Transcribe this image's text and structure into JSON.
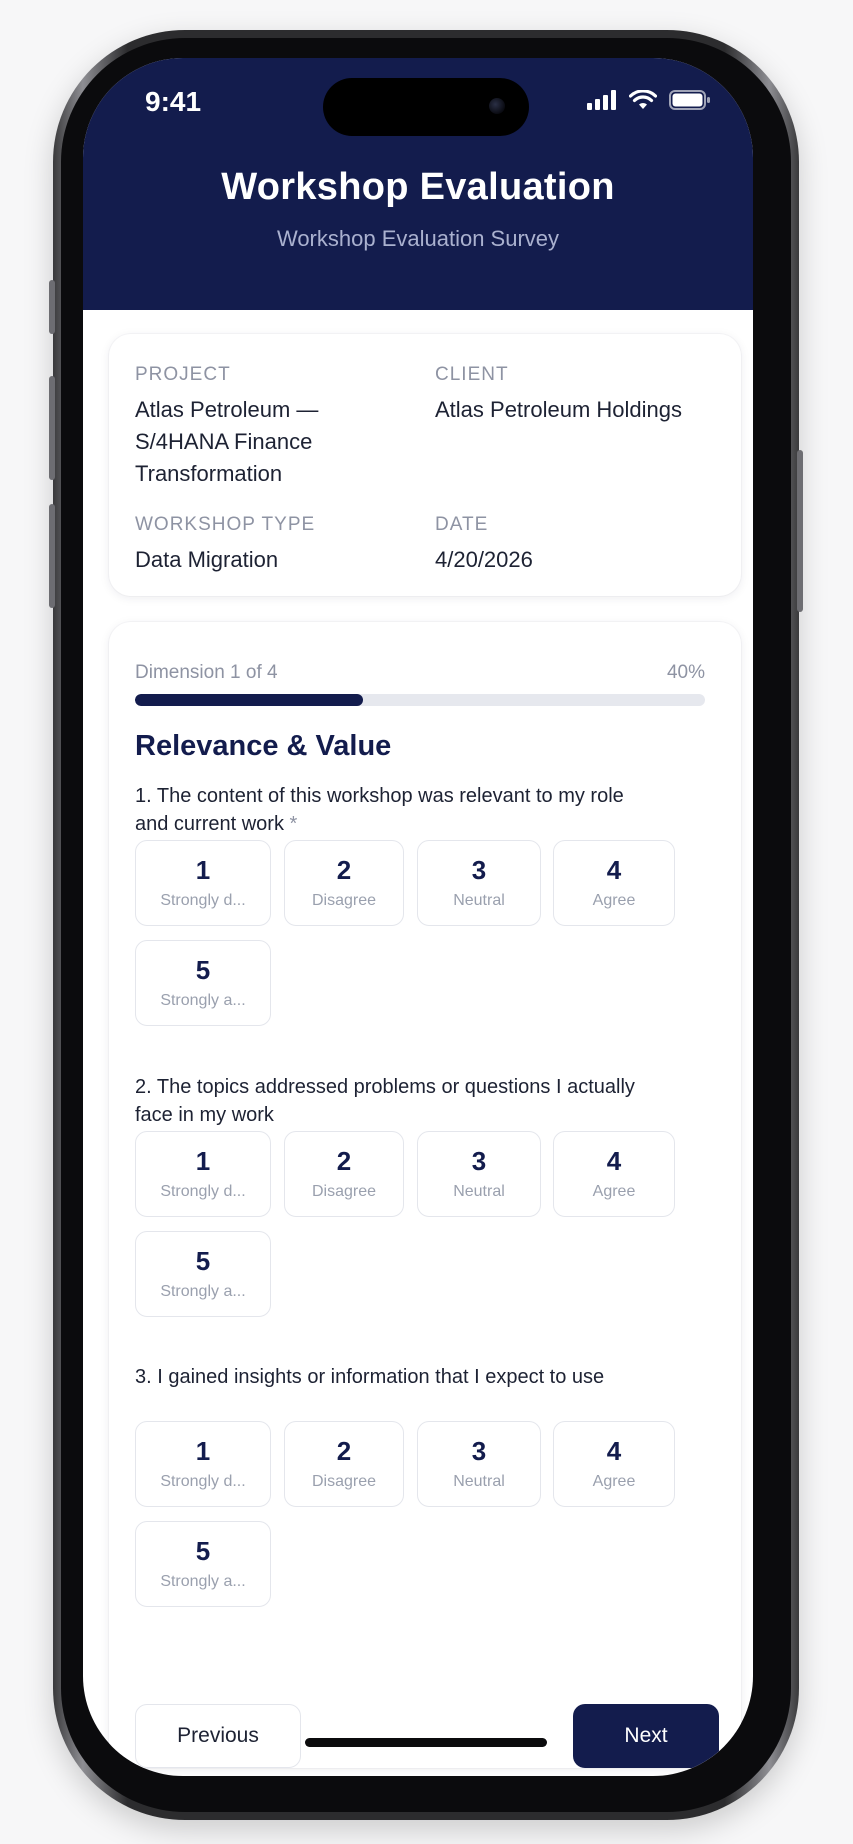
{
  "status_bar": {
    "time": "9:41"
  },
  "header": {
    "title": "Workshop Evaluation",
    "subtitle": "Workshop Evaluation Survey"
  },
  "info": {
    "project_label": "PROJECT",
    "project_value": "Atlas Petroleum — S/4HANA Finance Transformation",
    "client_label": "CLIENT",
    "client_value": "Atlas Petroleum Holdings",
    "type_label": "WORKSHOP TYPE",
    "type_value": "Data Migration",
    "date_label": "DATE",
    "date_value": "4/20/2026"
  },
  "progress": {
    "dimension_text": "Dimension 1 of 4",
    "percent_text": "40%",
    "percent": 40
  },
  "section": {
    "title": "Relevance & Value"
  },
  "scale_options": [
    {
      "num": "1",
      "label": "Strongly d..."
    },
    {
      "num": "2",
      "label": "Disagree"
    },
    {
      "num": "3",
      "label": "Neutral"
    },
    {
      "num": "4",
      "label": "Agree"
    },
    {
      "num": "5",
      "label": "Strongly a..."
    }
  ],
  "questions": [
    {
      "text": "1. The content of this workshop was relevant to my role and current work",
      "required_mark": "*"
    },
    {
      "text": "2. The topics addressed problems or questions I actually face in my work",
      "required_mark": ""
    },
    {
      "text": "3. I gained insights or information that I expect to use",
      "required_mark": ""
    }
  ],
  "nav": {
    "previous_label": "Previous",
    "next_label": "Next"
  },
  "colors": {
    "primary": "#131c4d",
    "muted_text": "#8e93a3",
    "border": "#e4e6ec"
  }
}
